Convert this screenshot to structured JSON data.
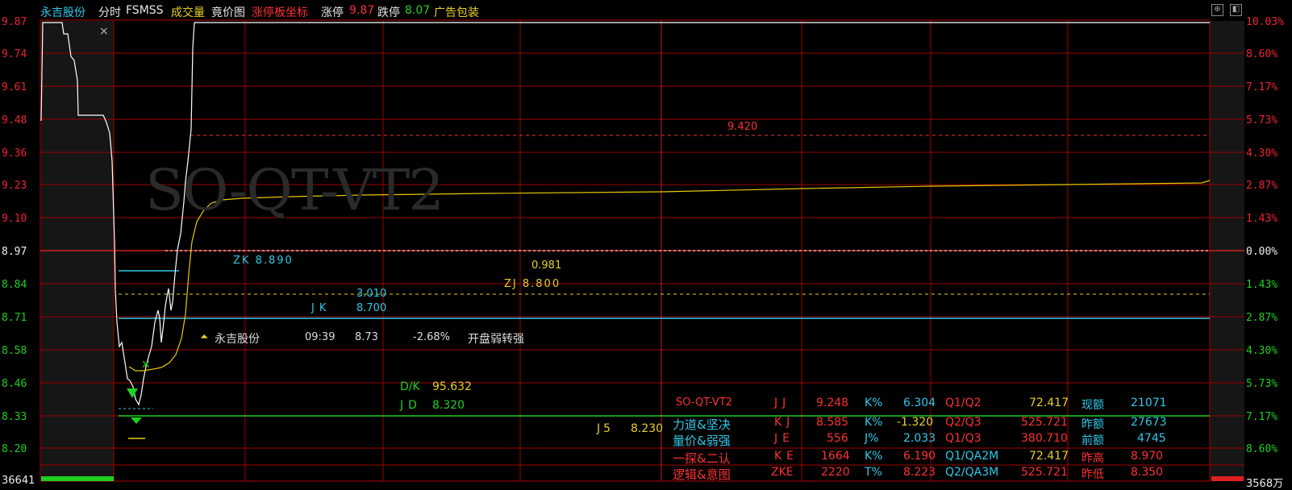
{
  "header": {
    "stock_name": "永吉股份",
    "items": [
      "分时",
      "FSMSS",
      "成交量",
      "竟价图",
      "涨停板坐标"
    ],
    "limit_up_label": "涨停",
    "limit_up_value": "9.87",
    "limit_down_label": "跌停",
    "limit_down_value": "8.07",
    "ad_label": "广告包装"
  },
  "y_axis_left": [
    "9.87",
    "9.74",
    "9.61",
    "9.48",
    "9.36",
    "9.23",
    "9.10",
    "8.97",
    "8.84",
    "8.71",
    "8.58",
    "8.46",
    "8.33",
    "8.20"
  ],
  "y_axis_right": [
    "10.03%",
    "8.60%",
    "7.17%",
    "5.73%",
    "4.30%",
    "2.87%",
    "1.43%",
    "0.00%",
    "1.43%",
    "2.87%",
    "4.30%",
    "5.73%",
    "7.17%",
    "8.60%"
  ],
  "volume_left": "36641",
  "volume_right": "3568万",
  "watermark": "SO-QT-VT2",
  "annotations": {
    "level_9420": "9.420",
    "zk": "ZK 8.890",
    "val_0981": "0.981",
    "zj": "ZJ  8.800",
    "val_3010": "3.010",
    "jk": "JK",
    "jk_val": "8.700",
    "dk_label": "D/K",
    "dk_val": "95.632",
    "jd_label": "JD",
    "jd_val": "8.320",
    "j5_label": "J5",
    "j5_val": "8.230"
  },
  "event": {
    "arrow": "⏶",
    "name": "永吉股份",
    "time": "09:39",
    "price": "8.73",
    "change": "-2.68%",
    "note": "开盘弱转强"
  },
  "table": {
    "rows": [
      {
        "c1": "SO-QT-VT2",
        "c2": "JJ",
        "c3": "9.248",
        "c4": "K%",
        "c5": "6.304",
        "c6": "Q1/Q2",
        "c7": "72.417",
        "c8": "现额",
        "c9": "21071"
      },
      {
        "c1": "力道&坚决",
        "c2": "KJ",
        "c3": "8.585",
        "c4": "K%",
        "c5": "-1.320",
        "c6": "Q2/Q3",
        "c7": "525.721",
        "c8": "昨额",
        "c9": "27673"
      },
      {
        "c1": "量价&弱强",
        "c2": "JE",
        "c3": "556",
        "c4": "J%",
        "c5": "2.033",
        "c6": "Q1/Q3",
        "c7": "380.710",
        "c8": "前额",
        "c9": "4745"
      },
      {
        "c1": "一探&二认",
        "c2": "KE",
        "c3": "1664",
        "c4": "K%",
        "c5": "6.190",
        "c6": "Q1/QA2M",
        "c7": "72.417",
        "c8": "昨高",
        "c9": "8.970"
      },
      {
        "c1": "逻辑&意图",
        "c2": "ZKE",
        "c3": "2220",
        "c4": "T%",
        "c5": "8.223",
        "c6": "Q2/QA3M",
        "c7": "525.721",
        "c8": "昨低",
        "c9": "8.350"
      }
    ]
  },
  "colors": {
    "grid": "#b00000",
    "price_line": "#ffffff",
    "avg_line": "#e8c800",
    "cyan": "#30c8e8",
    "green": "#20d020",
    "red": "#ff3030",
    "yellow": "#e8d020"
  }
}
